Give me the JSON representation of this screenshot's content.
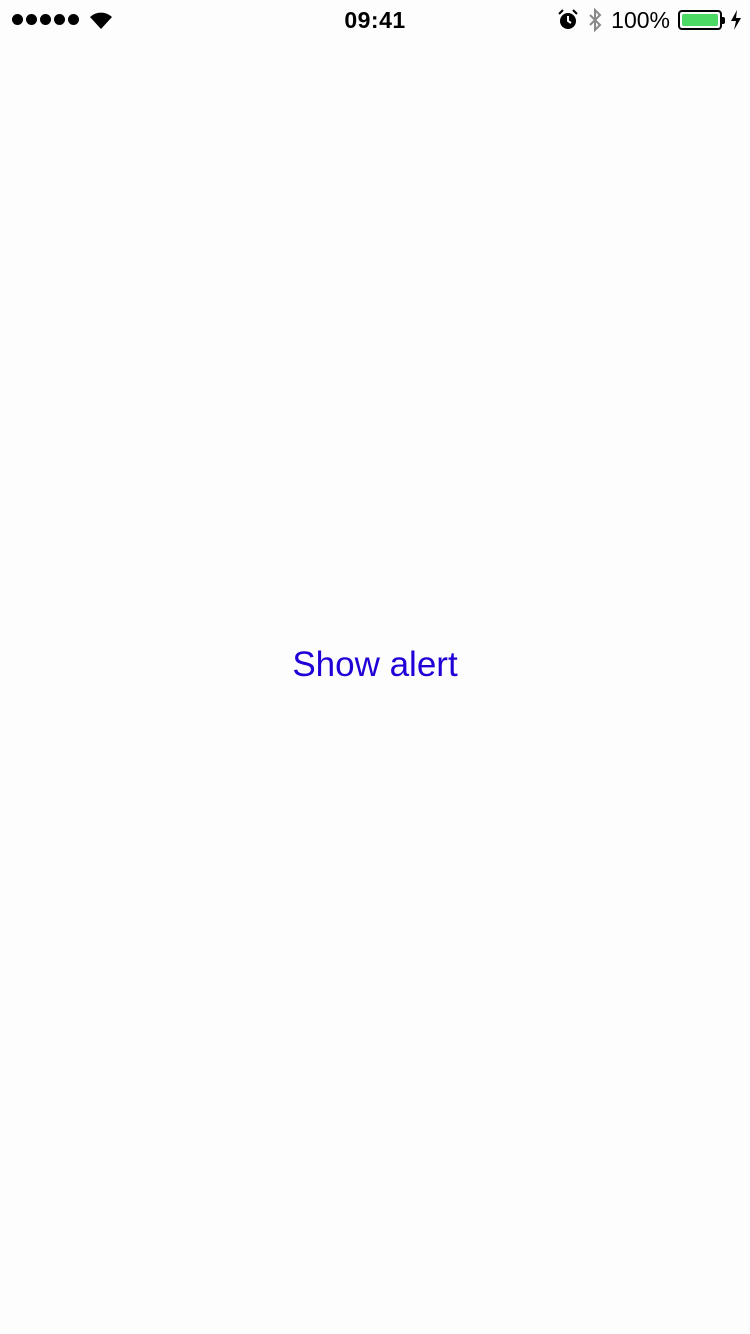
{
  "status_bar": {
    "signal_icon": "signal-dots-icon",
    "wifi_icon": "wifi-icon",
    "time": "09:41",
    "alarm_icon": "alarm-icon",
    "bluetooth_icon": "bluetooth-icon",
    "battery_percent": "100%",
    "battery_level": 1.0,
    "battery_color": "#4cd964",
    "charging_icon": "charging-bolt-icon"
  },
  "main": {
    "show_alert_label": "Show alert",
    "accent_color": "#1f00d6"
  }
}
